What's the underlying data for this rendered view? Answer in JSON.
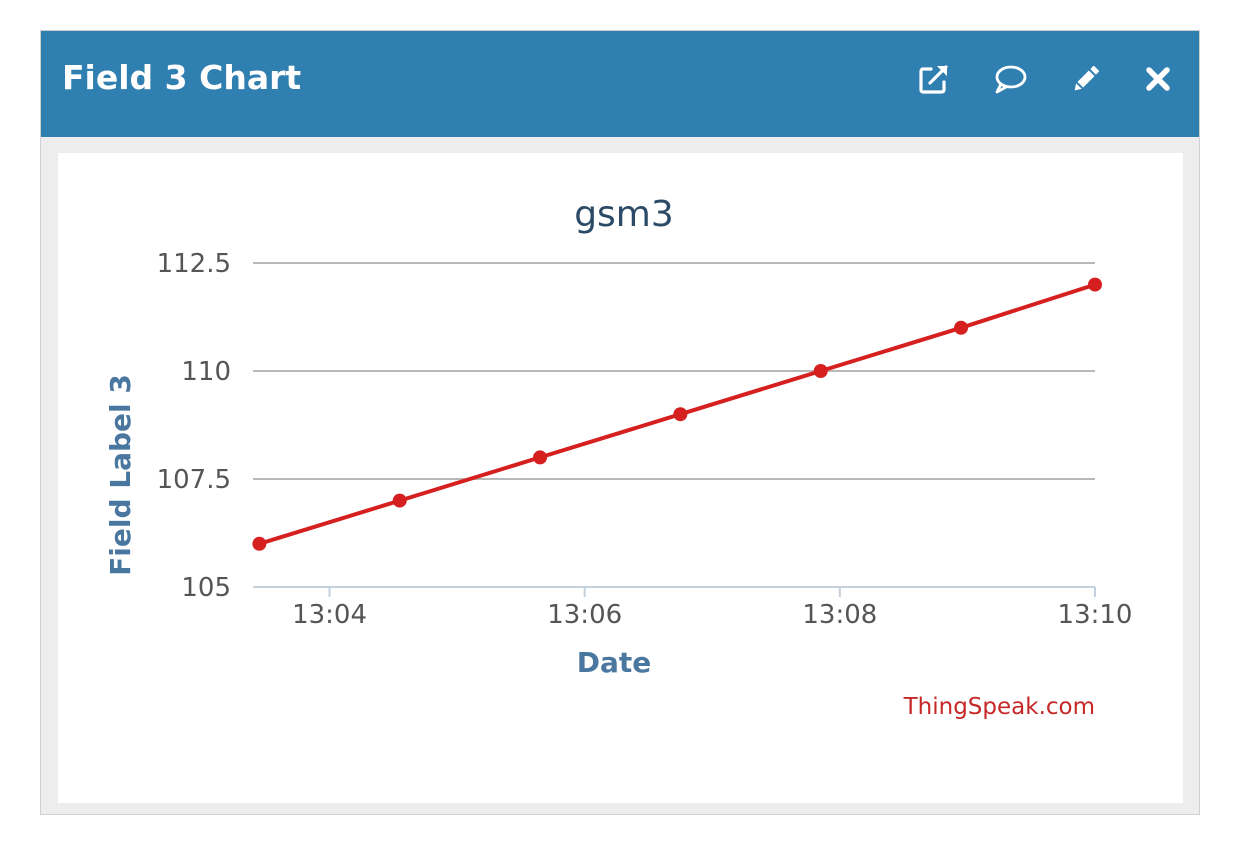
{
  "window": {
    "title": "Field 3 Chart",
    "actions": [
      {
        "name": "open-external-icon",
        "label": "open in new window"
      },
      {
        "name": "comment-icon",
        "label": "comments"
      },
      {
        "name": "pencil-icon",
        "label": "edit"
      },
      {
        "name": "close-icon",
        "label": "close"
      }
    ],
    "header_color": "#2f7fb0"
  },
  "chart_data": {
    "type": "line",
    "title": "gsm3",
    "xlabel": "Date",
    "ylabel": "Field Label 3",
    "x_tick_labels": [
      "13:04",
      "13:06",
      "13:08",
      "13:10"
    ],
    "x_tick_minutes": [
      4,
      6,
      8,
      10
    ],
    "x_range_minutes": [
      3.4,
      10
    ],
    "ylim": [
      105,
      112.5
    ],
    "y_ticks": [
      "105",
      "107.5",
      "110",
      "112.5"
    ],
    "y_tick_values": [
      105,
      107.5,
      110,
      112.5
    ],
    "grid": true,
    "series": [
      {
        "color": "#d62020",
        "x_minutes": [
          3.45,
          4.55,
          5.65,
          6.75,
          7.85,
          8.95,
          10.0
        ],
        "values": [
          106,
          107,
          108,
          109,
          110,
          111,
          112
        ]
      }
    ],
    "credit": "ThingSpeak.com",
    "title_color": "#2b4a66",
    "axis_label_color": "#4a77a0",
    "credit_color": "#c62828"
  }
}
